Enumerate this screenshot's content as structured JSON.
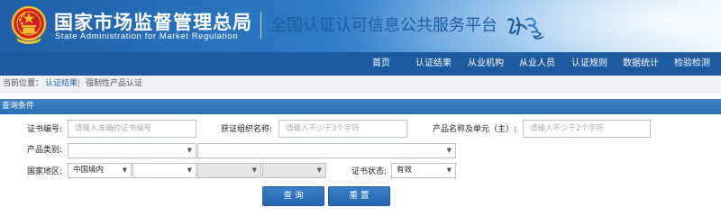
{
  "header": {
    "agency_cn": "国家市场监督管理总局",
    "agency_en": "State Administration  for  Market Regulation",
    "platform_title": "全国认证认可信息公共服务平台",
    "colors": {
      "banner_dark": "#1f5fa8",
      "banner_light": "#d9ecfa",
      "title_blue": "#1e5c9f",
      "emblem_red": "#d02020",
      "emblem_gold": "#f2c12e"
    },
    "icons": {
      "emblem": "national-emblem-icon",
      "logo": "cnca-logo-icon"
    }
  },
  "nav": {
    "color": "#1d5aa0",
    "items": [
      {
        "label": "首页"
      },
      {
        "label": "认证结果"
      },
      {
        "label": "从业机构"
      },
      {
        "label": "从业人员"
      },
      {
        "label": "认证规则"
      },
      {
        "label": "数据统计"
      },
      {
        "label": "检验检测"
      }
    ]
  },
  "breadcrumb": {
    "prefix": "当前位置：",
    "link": "认证结果",
    "separator": "|",
    "current": "强制性产品认证"
  },
  "panel": {
    "title": "查询条件",
    "color": "#2b6db2"
  },
  "form": {
    "cert_no": {
      "label": "证书编号:",
      "value": "",
      "placeholder": "请输入准确的证书编号"
    },
    "org_name": {
      "label": "获证组织名称:",
      "value": "",
      "placeholder": "请输入不少于3个字符"
    },
    "product_unit": {
      "label": "产品名称及单元（主）:",
      "value": "",
      "placeholder": "请输入不少于2个字符"
    },
    "category": {
      "label": "产品类别:",
      "select1": "",
      "select2": ""
    },
    "region": {
      "label": "国家地区:",
      "select1": "中国境内",
      "select2": "",
      "select3": "",
      "select4": ""
    },
    "status": {
      "label": "证书状态:",
      "value": "有效"
    },
    "dropdown_icon": "caret-down-icon"
  },
  "buttons": {
    "search": "查 询",
    "reset": "重 置"
  }
}
